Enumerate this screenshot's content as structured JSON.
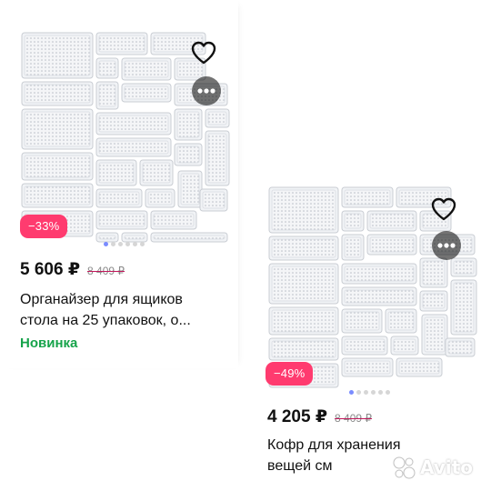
{
  "listings": [
    {
      "price": "5 606 ₽",
      "old_price": "8 409 ₽",
      "discount": "−33%",
      "title_line1": "Органайзер для ящиков",
      "title_line2": "стола на 25 упаковок, о...",
      "tag": "Новинка",
      "gallery_dots": 6,
      "active_dot": 0
    },
    {
      "price": "4 205 ₽",
      "old_price": "8 409 ₽",
      "discount": "−49%",
      "title_line1": "Кофр для хранения",
      "title_line2": "вещей см",
      "gallery_dots": 6,
      "active_dot": 0
    }
  ],
  "icons": {
    "favorite": "heart-icon",
    "more": "more-dots-icon"
  },
  "colors": {
    "discount_badge": "#ff3b6f",
    "new_tag": "#16a34a",
    "strikethrough": "#c2185b",
    "active_dot": "#7a8cff"
  },
  "watermark": "Avito"
}
